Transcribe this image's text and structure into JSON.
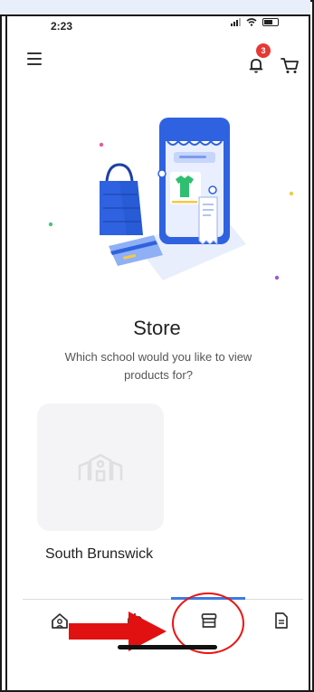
{
  "status": {
    "time": "2:23"
  },
  "header": {
    "menu_icon": "hamburger-menu-icon",
    "notification_icon": "bell-icon",
    "notification_count": "3",
    "cart_icon": "cart-icon"
  },
  "page": {
    "title": "Store",
    "subtitle": "Which school would you like to view products for?"
  },
  "schools": [
    {
      "name": "South Brunswick",
      "icon": "school-building-icon"
    }
  ],
  "tabs": [
    {
      "id": "home",
      "icon": "home-icon",
      "active": false
    },
    {
      "id": "robot",
      "icon": "robot-icon",
      "active": false
    },
    {
      "id": "store",
      "icon": "store-icon",
      "active": true
    },
    {
      "id": "document",
      "icon": "document-icon",
      "active": false
    }
  ],
  "colors": {
    "accent": "#3d7be0",
    "badge": "#e53935",
    "annotation": "#e11111",
    "card_bg": "#f4f4f6"
  }
}
